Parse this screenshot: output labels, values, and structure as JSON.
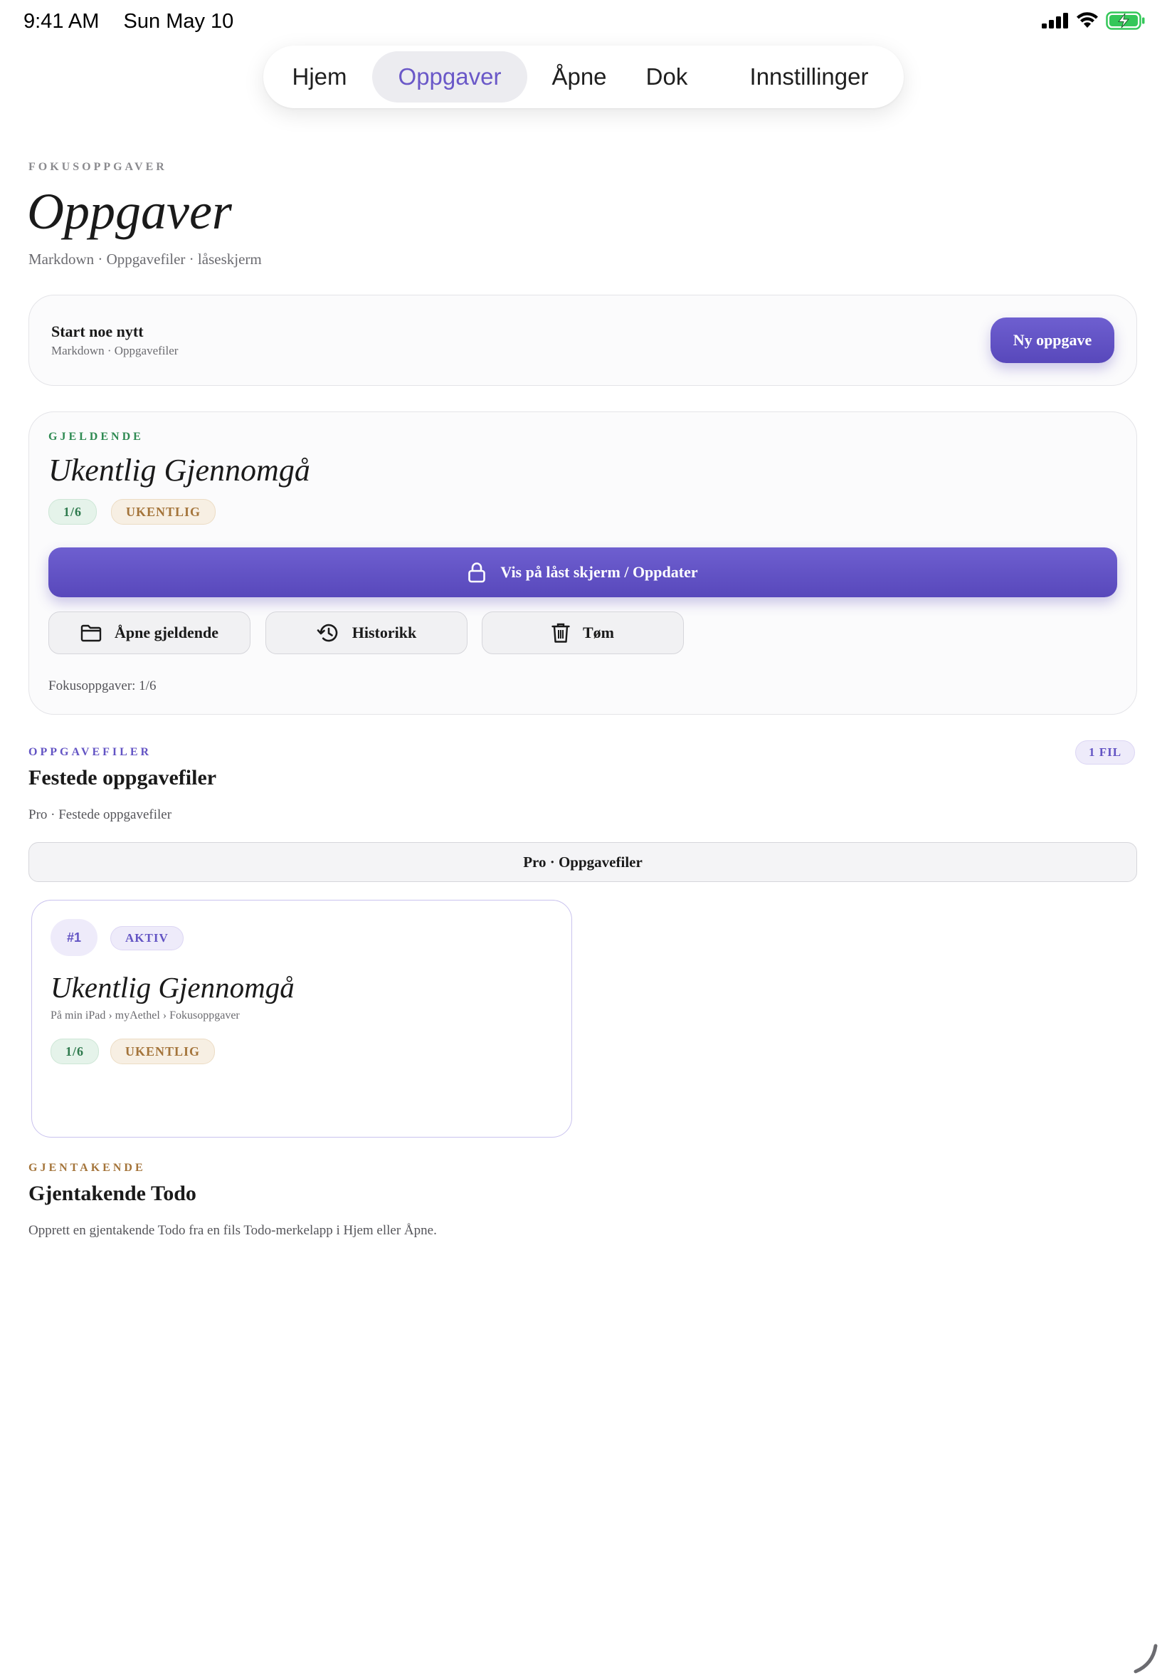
{
  "status": {
    "time": "9:41 AM",
    "date": "Sun May 10",
    "icons": [
      "cellular-signal-icon",
      "wifi-icon",
      "battery-charging-icon"
    ]
  },
  "nav": {
    "items": [
      {
        "label": "Hjem",
        "active": false
      },
      {
        "label": "Oppgaver",
        "active": true
      },
      {
        "label": "Åpne",
        "active": false
      },
      {
        "label": "Dok",
        "active": false
      },
      {
        "label": "Innstillinger",
        "active": false
      }
    ]
  },
  "header": {
    "eyebrow": "FOKUSOPPGAVER",
    "title": "Oppgaver",
    "subtitle": "Markdown · Oppgavefiler · låseskjerm"
  },
  "start_card": {
    "title": "Start noe nytt",
    "subtitle": "Markdown · Oppgavefiler",
    "button": "Ny oppgave"
  },
  "current": {
    "eyebrow": "GJELDENDE",
    "title": "Ukentlig Gjennomgå",
    "progress_chip": "1/6",
    "frequency_chip": "UKENTLIG",
    "lock_button": "Vis på låst skjerm / Oppdater",
    "open_button": "Åpne gjeldende",
    "history_button": "Historikk",
    "clear_button": "Tøm",
    "footer": "Fokusoppgaver: 1/6"
  },
  "files": {
    "eyebrow": "OPPGAVEFILER",
    "title": "Festede oppgavefiler",
    "count_badge": "1 FIL",
    "subtitle": "Pro · Festede oppgavefiler",
    "pro_button": "Pro · Oppgavefiler",
    "items": [
      {
        "index": "#1",
        "status": "AKTIV",
        "title": "Ukentlig Gjennomgå",
        "path": "På min iPad › myAethel › Fokusoppgaver",
        "progress": "1/6",
        "frequency": "UKENTLIG"
      }
    ]
  },
  "recurring": {
    "eyebrow": "GJENTAKENDE",
    "title": "Gjentakende Todo",
    "description": "Opprett en gjentakende Todo fra en fils Todo-merkelapp i Hjem eller Åpne."
  },
  "colors": {
    "accent": "#6a58c8",
    "primary_button": "#5f4fc2",
    "green": "#2e7a4d",
    "gold": "#a4743a",
    "eyebrow_gray": "#8a8a8e"
  }
}
